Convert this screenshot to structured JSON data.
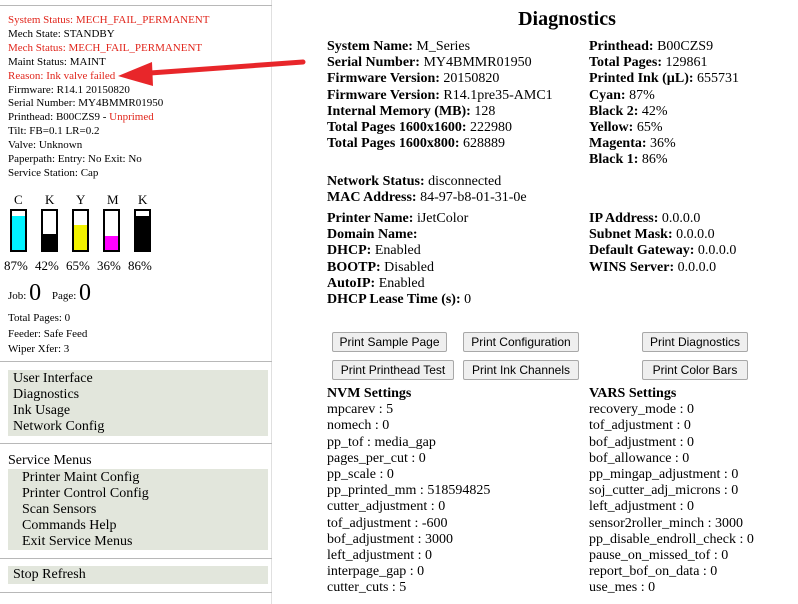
{
  "sidebar": {
    "status_lines": [
      {
        "text": "System Status: MECH_FAIL_PERMANENT",
        "red": true
      },
      {
        "text": "Mech State: STANDBY",
        "red": false
      },
      {
        "text": "Mech Status: MECH_FAIL_PERMANENT",
        "red": true
      },
      {
        "text": "Maint Status: MAINT",
        "red": false
      },
      {
        "text": "Reason: Ink valve failed",
        "red": true
      },
      {
        "text": "Firmware: R14.1 20150820",
        "red": false
      },
      {
        "text": "Serial Number: MY4BMMR01950",
        "red": false
      }
    ],
    "printhead_prefix": "Printhead: B00CZS9 - ",
    "printhead_state": "Unprimed",
    "status_lines_2": [
      "Tilt: FB=0.1 LR=0.2",
      "Valve: Unknown",
      "Paperpath: Entry: No Exit: No",
      "Service Station: Cap"
    ],
    "inks": [
      {
        "letter": "C",
        "pct": 87,
        "label": "87%",
        "color": "#00f2ff"
      },
      {
        "letter": "K",
        "pct": 42,
        "label": "42%",
        "color": "#000000"
      },
      {
        "letter": "Y",
        "pct": 65,
        "label": "65%",
        "color": "#f2f200"
      },
      {
        "letter": "M",
        "pct": 36,
        "label": "36%",
        "color": "#ff00ff"
      },
      {
        "letter": "K",
        "pct": 86,
        "label": "86%",
        "color": "#000000"
      }
    ],
    "job_label": "Job:",
    "job_value": "0",
    "page_label": "Page:",
    "page_value": "0",
    "counts": [
      "Total Pages: 0",
      "Feeder: Safe Feed",
      "Wiper Xfer: 3"
    ],
    "nav_items": [
      "User Interface",
      "Diagnostics",
      "Ink Usage",
      "Network Config"
    ],
    "service_title": "Service Menus",
    "service_items": [
      "Printer Maint Config",
      "Printer Control Config",
      "Scan Sensors",
      "Commands Help",
      "Exit Service Menus"
    ],
    "stop_refresh": "Stop Refresh"
  },
  "main": {
    "title": "Diagnostics",
    "left_info": [
      {
        "k": "System Name:",
        "v": " M_Series"
      },
      {
        "k": "Serial Number:",
        "v": " MY4BMMR01950"
      },
      {
        "k": "Firmware Version:",
        "v": " 20150820"
      },
      {
        "k": "Firmware Version:",
        "v": " R14.1pre35-AMC1"
      },
      {
        "k": "Internal Memory (MB):",
        "v": " 128"
      },
      {
        "k": "Total Pages 1600x1600:",
        "v": " 222980"
      },
      {
        "k": "Total Pages 1600x800:",
        "v": " 628889"
      }
    ],
    "right_info": [
      {
        "k": "Printhead:",
        "v": " B00CZS9"
      },
      {
        "k": "Total Pages:",
        "v": " 129861"
      },
      {
        "k": "Printed Ink (µL):",
        "v": " 655731"
      },
      {
        "k": "Cyan:",
        "v": " 87%"
      },
      {
        "k": "Black 2:",
        "v": " 42%"
      },
      {
        "k": "Yellow:",
        "v": " 65%"
      },
      {
        "k": "Magenta:",
        "v": " 36%"
      },
      {
        "k": "Black 1:",
        "v": " 86%"
      }
    ],
    "network": [
      {
        "k": "Network Status:",
        "v": " disconnected"
      },
      {
        "k": "MAC Address:",
        "v": " 84-97-b8-01-31-0e"
      }
    ],
    "net_left": [
      {
        "k": "Printer Name:",
        "v": " iJetColor"
      },
      {
        "k": "Domain Name:",
        "v": ""
      },
      {
        "k": "DHCP:",
        "v": " Enabled"
      },
      {
        "k": "BOOTP:",
        "v": " Disabled"
      },
      {
        "k": "AutoIP:",
        "v": " Enabled"
      },
      {
        "k": "DHCP Lease Time (s):",
        "v": " 0"
      }
    ],
    "net_right": [
      {
        "k": "IP Address:",
        "v": " 0.0.0.0"
      },
      {
        "k": "Subnet Mask:",
        "v": " 0.0.0.0"
      },
      {
        "k": "Default Gateway:",
        "v": " 0.0.0.0"
      },
      {
        "k": "WINS Server:",
        "v": " 0.0.0.0"
      }
    ],
    "buttons": {
      "print_sample": "Print Sample Page",
      "print_config": "Print Configuration",
      "print_diag": "Print Diagnostics",
      "print_head_test": "Print Printhead Test",
      "print_ink_channels": "Print Ink Channels",
      "print_color_bars": "Print Color Bars"
    },
    "nvm_title": "NVM Settings",
    "nvm_items": [
      "mpcarev : 5",
      "nomech : 0",
      "pp_tof : media_gap",
      "pages_per_cut : 0",
      "pp_scale : 0",
      "pp_printed_mm : 518594825",
      "cutter_adjustment : 0",
      "tof_adjustment : -600",
      "bof_adjustment : 3000",
      "left_adjustment : 0",
      "interpage_gap : 0",
      "cutter_cuts : 5"
    ],
    "vars_title": "VARS Settings",
    "vars_items": [
      "recovery_mode : 0",
      "tof_adjustment : 0",
      "bof_adjustment : 0",
      "bof_allowance : 0",
      "pp_mingap_adjustment : 0",
      "soj_cutter_adj_microns : 0",
      "left_adjustment : 0",
      "sensor2roller_minch : 3000",
      "pp_disable_endroll_check : 0",
      "pause_on_missed_tof : 0",
      "report_bof_on_data : 0",
      "use_mes : 0"
    ]
  },
  "annotation": {
    "color": "#e8262a"
  }
}
